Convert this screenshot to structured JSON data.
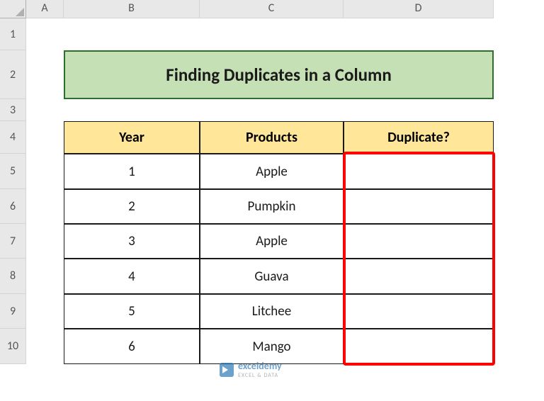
{
  "columns": [
    "",
    "A",
    "B",
    "C",
    "D"
  ],
  "rows": [
    "1",
    "2",
    "3",
    "4",
    "5",
    "6",
    "7",
    "8",
    "9",
    "10"
  ],
  "title": "Finding Duplicates in a Column",
  "table": {
    "headers": [
      "Year",
      "Products",
      "Duplicate?"
    ],
    "data": [
      {
        "year": "1",
        "product": "Apple",
        "dup": ""
      },
      {
        "year": "2",
        "product": "Pumpkin",
        "dup": ""
      },
      {
        "year": "3",
        "product": "Apple",
        "dup": ""
      },
      {
        "year": "4",
        "product": "Guava",
        "dup": ""
      },
      {
        "year": "5",
        "product": "Litchee",
        "dup": ""
      },
      {
        "year": "6",
        "product": "Mango",
        "dup": ""
      }
    ]
  },
  "watermark": {
    "brand": "exceldemy",
    "sub": "EXCEL & DATA"
  }
}
